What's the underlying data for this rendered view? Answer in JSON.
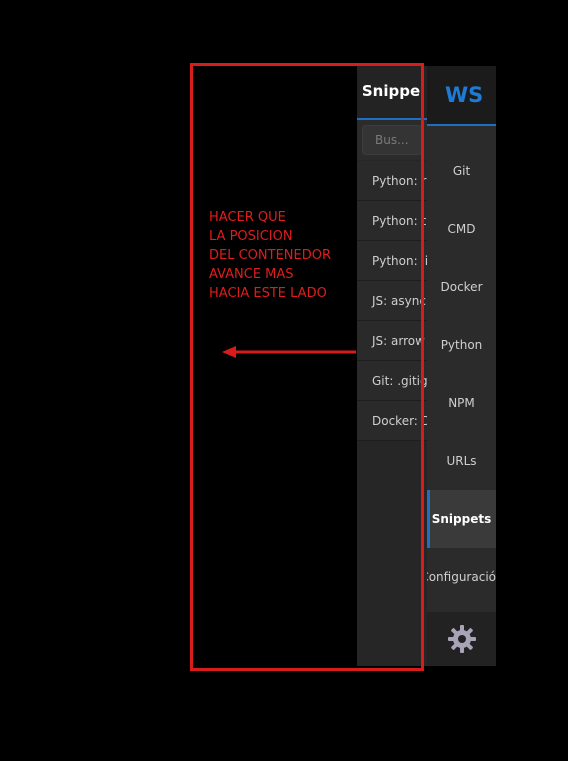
{
  "snippets": {
    "title": "Snippe",
    "search_placeholder": "Bus...",
    "items": [
      "Python: r",
      "Python: t",
      "Python: lis",
      "JS: async",
      "JS: arrow",
      "Git: .gitig",
      "Docker: D"
    ]
  },
  "nav": {
    "logo": "WS",
    "items": [
      {
        "label": "Git",
        "active": false
      },
      {
        "label": "CMD",
        "active": false
      },
      {
        "label": "Docker",
        "active": false
      },
      {
        "label": "Python",
        "active": false
      },
      {
        "label": "NPM",
        "active": false
      },
      {
        "label": "URLs",
        "active": false
      },
      {
        "label": "Snippets",
        "active": true
      },
      {
        "label": "Configuració",
        "active": false
      }
    ],
    "settings_icon": "gear-icon"
  },
  "annotation": {
    "lines": [
      "HACER QUE",
      "LA POSICION",
      "DEL CONTENEDOR",
      "AVANCE MAS",
      "HACIA ESTE LADO"
    ],
    "color": "#e01d1d"
  },
  "colors": {
    "accent": "#1f6fc1",
    "logo": "#1f7ad6",
    "panel_bg": "#2b2b2b",
    "annotation": "#d81b1b"
  }
}
